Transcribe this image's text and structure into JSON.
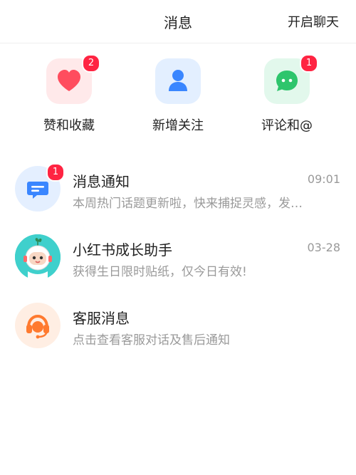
{
  "header": {
    "title": "消息",
    "action_label": "开启聊天"
  },
  "quick_actions": [
    {
      "label": "赞和收藏",
      "icon": "heart-icon",
      "badge": "2",
      "color": "#ff4d5e"
    },
    {
      "label": "新增关注",
      "icon": "person-icon",
      "badge": "",
      "color": "#3a86ff"
    },
    {
      "label": "评论和@",
      "icon": "chat-bubble-icon",
      "badge": "1",
      "color": "#2ec56c"
    }
  ],
  "messages": [
    {
      "title": "消息通知",
      "preview": "本周热门话题更新啦，快来捕捉灵感，发…",
      "time": "09:01",
      "badge": "1",
      "icon": "notification-bubble-icon"
    },
    {
      "title": "小红书成长助手",
      "preview": "获得生日限时贴纸，仅今日有效!",
      "time": "03-28",
      "badge": "",
      "icon": "astronaut-avatar-icon"
    },
    {
      "title": "客服消息",
      "preview": "点击查看客服对话及售后通知",
      "time": "",
      "badge": "",
      "icon": "headset-icon"
    }
  ],
  "colors": {
    "badge": "#ff2442",
    "accent_blue": "#3a86ff",
    "accent_orange": "#ff7a2f"
  }
}
